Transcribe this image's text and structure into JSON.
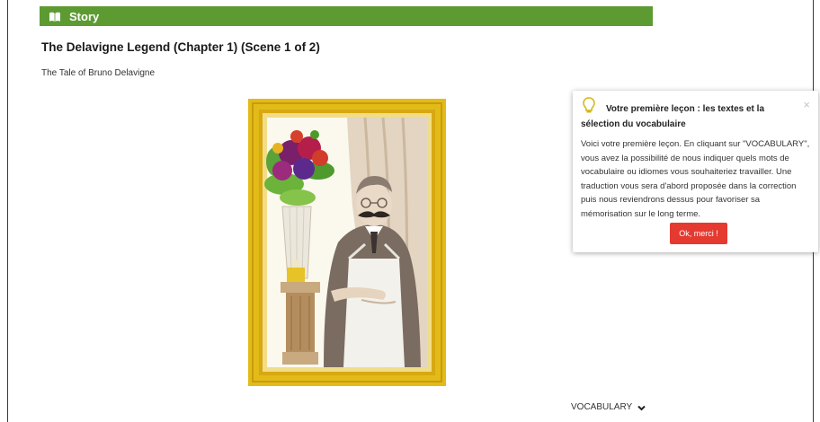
{
  "story_bar": {
    "label": "Story",
    "color": "#5d9b32",
    "icon": "book-icon"
  },
  "lesson": {
    "title": "The Delavigne Legend (Chapter 1) (Scene 1 of 2)",
    "subtitle": "The Tale of Bruno Delavigne"
  },
  "illustration": {
    "icon": "framed-portrait-illustration",
    "frame_color": "#e2bb18"
  },
  "popup": {
    "icon": "lightbulb-icon",
    "title": "Votre première leçon : les textes et la sélection du vocabulaire",
    "close_label": "×",
    "body": "Voici votre première leçon. En cliquant sur \"VOCABULARY\", vous avez la possibilité de nous indiquer quels mots de vocabulaire ou idiomes vous souhaiteriez travailler. Une traduction vous sera d'abord proposée dans la correction puis nous reviendrons dessus pour favoriser sa mémorisation sur le long terme.",
    "button_label": "Ok, merci !",
    "button_color": "#e53a30"
  },
  "vocabulary": {
    "label": "VOCABULARY",
    "icon": "chevron-down-icon"
  }
}
